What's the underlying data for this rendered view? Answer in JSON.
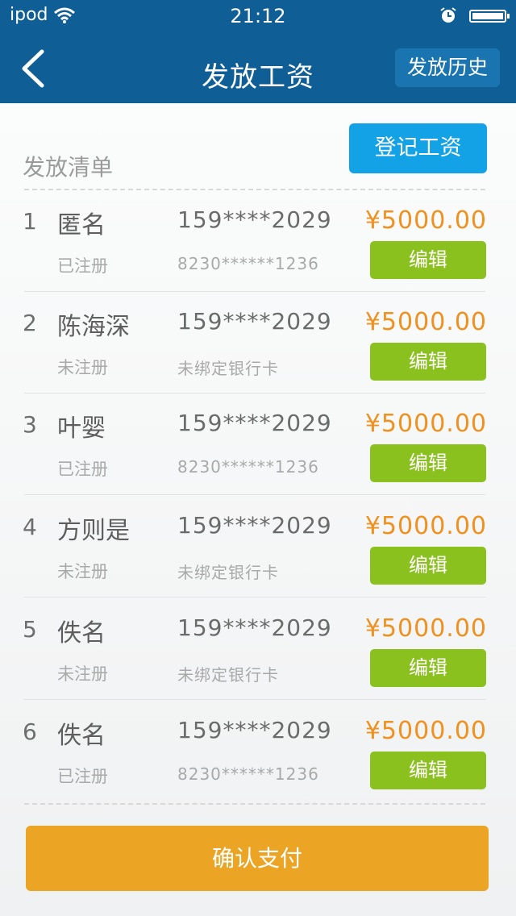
{
  "status_bar": {
    "carrier": "ipod",
    "time": "21:12",
    "icons": [
      "wifi-icon",
      "alarm-icon",
      "battery-icon"
    ],
    "battery_level": 1.0
  },
  "nav": {
    "back_icon": "chevron-left-icon",
    "title": "发放工资",
    "history_label": "发放历史"
  },
  "list": {
    "title": "发放清单",
    "register_label": "登记工资",
    "items": [
      {
        "index": "1",
        "name": "匿名",
        "status": "已注册",
        "phone": "159****2029",
        "bank": "8230******1236",
        "amount": "¥5000.00",
        "edit_label": "编辑"
      },
      {
        "index": "2",
        "name": "陈海深",
        "status": "未注册",
        "phone": "159****2029",
        "bank": "未绑定银行卡",
        "amount": "¥5000.00",
        "edit_label": "编辑"
      },
      {
        "index": "3",
        "name": "叶婴",
        "status": "已注册",
        "phone": "159****2029",
        "bank": "8230******1236",
        "amount": "¥5000.00",
        "edit_label": "编辑"
      },
      {
        "index": "4",
        "name": "方则是",
        "status": "未注册",
        "phone": "159****2029",
        "bank": "未绑定银行卡",
        "amount": "¥5000.00",
        "edit_label": "编辑"
      },
      {
        "index": "5",
        "name": "佚名",
        "status": "未注册",
        "phone": "159****2029",
        "bank": "未绑定银行卡",
        "amount": "¥5000.00",
        "edit_label": "编辑"
      },
      {
        "index": "6",
        "name": "佚名",
        "status": "已注册",
        "phone": "159****2029",
        "bank": "8230******1236",
        "amount": "¥5000.00",
        "edit_label": "编辑"
      }
    ]
  },
  "confirm_label": "确认支付",
  "colors": {
    "header": "#0f5f96",
    "register_button": "#13a2e6",
    "edit_button": "#8bc11f",
    "amount": "#f0901e",
    "confirm_button": "#eba424"
  }
}
